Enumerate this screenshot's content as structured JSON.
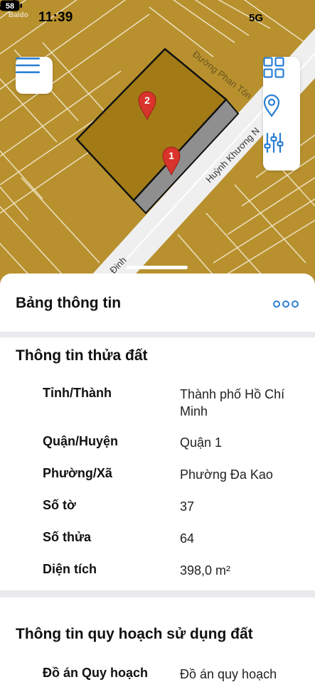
{
  "status_bar": {
    "time": "11:39",
    "network": "5G",
    "battery": "58",
    "watermark": "Baldo"
  },
  "map": {
    "street_labels": [
      "Đường Phan Tôn",
      "Huỳnh Khương N",
      "Đinh"
    ],
    "markers": [
      {
        "label": "1",
        "color": "#d9342b"
      },
      {
        "label": "2",
        "color": "#d9342b"
      }
    ],
    "parcel_fill": "#a27b16",
    "parcel_strip_fill": "#8f8f8f",
    "background_color": "#b8912e",
    "road_color": "#efefef"
  },
  "controls": {
    "menu_icon": "hamburger-icon",
    "layers_icon": "grid-icon",
    "location_icon": "location-pin-icon",
    "filter_icon": "sliders-icon"
  },
  "sheet": {
    "title": "Bảng thông tin",
    "more_icon": "more-icon"
  },
  "land_info": {
    "title": "Thông tin thửa đất",
    "rows": [
      {
        "label": "Tỉnh/Thành",
        "value": "Thành phố Hồ Chí Minh"
      },
      {
        "label": "Quận/Huyện",
        "value": "Quận 1"
      },
      {
        "label": "Phường/Xã",
        "value": "Phường Đa Kao"
      },
      {
        "label": "Số tờ",
        "value": "37"
      },
      {
        "label": "Số thửa",
        "value": "64"
      },
      {
        "label": "Diện tích",
        "value": "398,0 m²"
      }
    ]
  },
  "planning_info": {
    "title": "Thông tin quy hoạch sử dụng đất",
    "rows": [
      {
        "label": "Đồ án Quy hoạch",
        "value": "Đồ án quy hoạch"
      }
    ]
  },
  "colors": {
    "accent": "#2a7fd4",
    "card_bg": "#ffffff",
    "sheet_bg": "#e9e9ee"
  }
}
